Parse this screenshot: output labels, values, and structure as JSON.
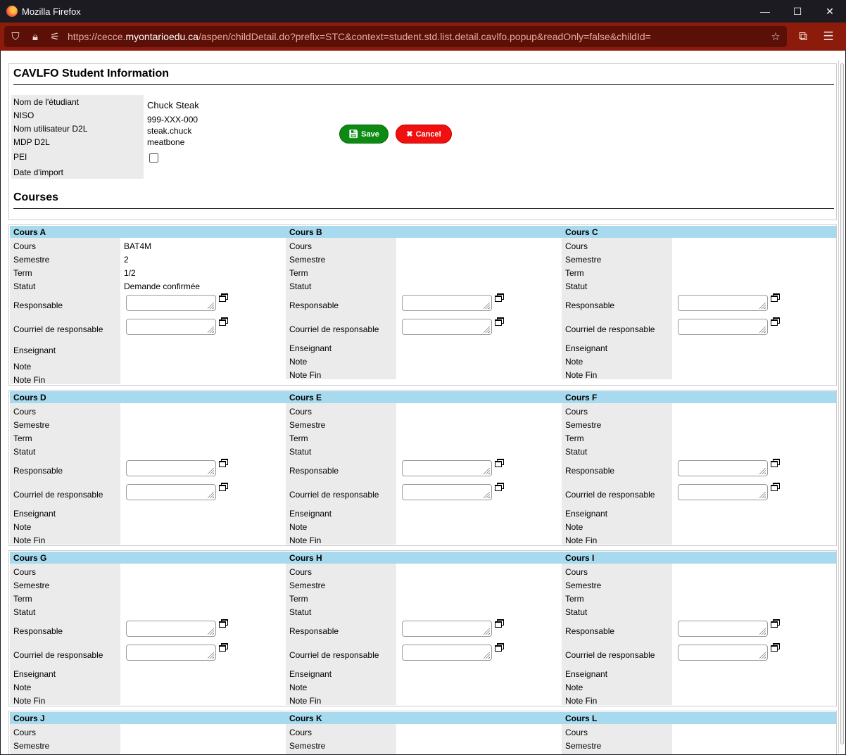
{
  "window": {
    "title": "Mozilla Firefox",
    "minimize": "—",
    "maximize": "☐",
    "close": "✕"
  },
  "urlbar": {
    "prefix": "https://cecce.",
    "domain": "myontarioedu.ca",
    "path": "/aspen/childDetail.do?prefix=STC&context=student.std.list.detail.cavlfo.popup&readOnly=false&childId="
  },
  "page": {
    "title": "CAVLFO Student Information",
    "courses_heading": "Courses",
    "save_label": "Save",
    "cancel_label": "Cancel"
  },
  "student": {
    "labels": [
      "Nom de l'étudiant",
      "NISO",
      "Nom utilisateur D2L",
      "MDP D2L",
      "PEI",
      "Date d'import"
    ],
    "name": "Chuck Steak",
    "niso": "999-XXX-000",
    "d2l_user": "steak.chuck",
    "d2l_password": "meatbone",
    "pei_checked": false
  },
  "field_labels": {
    "cours": "Cours",
    "semestre": "Semestre",
    "term": "Term",
    "statut": "Statut",
    "responsable": "Responsable",
    "courriel": "Courriel de responsable",
    "enseignant": "Enseignant",
    "note": "Note",
    "note_fin": "Note Fin"
  },
  "course_groups": [
    [
      {
        "title": "Cours A",
        "cours": "BAT4M",
        "semestre": "2",
        "term": "1/2",
        "statut": "Demande confirmée"
      },
      {
        "title": "Cours B",
        "cours": "",
        "semestre": "",
        "term": "",
        "statut": ""
      },
      {
        "title": "Cours C",
        "cours": "",
        "semestre": "",
        "term": "",
        "statut": ""
      }
    ],
    [
      {
        "title": "Cours D",
        "cours": "",
        "semestre": "",
        "term": "",
        "statut": ""
      },
      {
        "title": "Cours E",
        "cours": "",
        "semestre": "",
        "term": "",
        "statut": ""
      },
      {
        "title": "Cours F",
        "cours": "",
        "semestre": "",
        "term": "",
        "statut": ""
      }
    ],
    [
      {
        "title": "Cours G",
        "cours": "",
        "semestre": "",
        "term": "",
        "statut": ""
      },
      {
        "title": "Cours H",
        "cours": "",
        "semestre": "",
        "term": "",
        "statut": ""
      },
      {
        "title": "Cours I",
        "cours": "",
        "semestre": "",
        "term": "",
        "statut": ""
      }
    ],
    [
      {
        "title": "Cours J",
        "cours": "",
        "semestre": "",
        "term": "",
        "statut": ""
      },
      {
        "title": "Cours K",
        "cours": "",
        "semestre": "",
        "term": "",
        "statut": ""
      },
      {
        "title": "Cours L",
        "cours": "",
        "semestre": "",
        "term": "",
        "statut": ""
      }
    ]
  ],
  "colors": {
    "header_bg": "#a7daee",
    "label_bg": "#ebebeb",
    "save": "#0c8a12",
    "cancel": "#f01010",
    "navbar": "#8c1b0b"
  }
}
